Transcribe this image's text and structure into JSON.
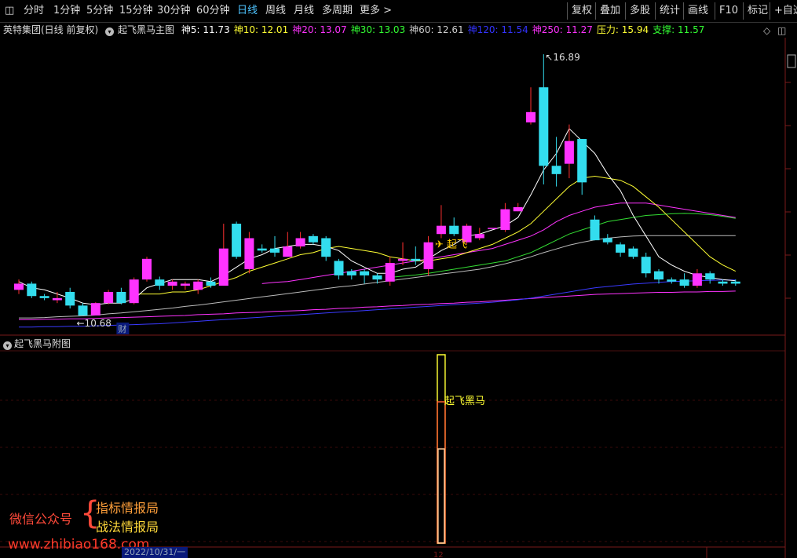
{
  "toolbar": {
    "periods": [
      "分时",
      "1分钟",
      "5分钟",
      "15分钟",
      "30分钟",
      "60分钟",
      "日线",
      "周线",
      "月线",
      "多周期",
      "更多 >"
    ],
    "active_period": "日线",
    "right_buttons": [
      "复权",
      "叠加",
      "多股",
      "统计",
      "画线",
      "F10",
      "标记",
      "+自选"
    ]
  },
  "info": {
    "stock": "英特集团(日线 前复权)",
    "indicator": "起飞黑马主图",
    "ma": [
      {
        "label": "神5: 11.73",
        "color": "#ffffff"
      },
      {
        "label": "神10: 12.01",
        "color": "#ffff33"
      },
      {
        "label": "神20: 13.07",
        "color": "#ff33ff"
      },
      {
        "label": "神30: 13.03",
        "color": "#33ff33"
      },
      {
        "label": "神60: 12.61",
        "color": "#cccccc"
      },
      {
        "label": "神120: 11.54",
        "color": "#3333ff"
      },
      {
        "label": "神250: 11.27",
        "color": "#ff33ff"
      },
      {
        "label": "压力: 15.94",
        "color": "#ffff33"
      },
      {
        "label": "支撑: 11.57",
        "color": "#33ff33"
      }
    ]
  },
  "sub": {
    "title": "起飞黑马附图",
    "signal_label": "起飞黑马"
  },
  "watermark": {
    "line1": "微信公众号",
    "brace": "{",
    "line2": "指标情报局",
    "line3": "战法情报局",
    "url": "www.zhibiao168.com"
  },
  "axis": {
    "date_box": "2022/10/31/一"
  },
  "chart_data": {
    "type": "candlestick",
    "ylim": [
      10.3,
      17.4
    ],
    "up_color": "#ff33ff",
    "down_color": "#33ddee",
    "candles": [
      [
        11.3,
        11.45,
        11.55,
        11.2
      ],
      [
        11.45,
        11.15,
        11.5,
        11.1
      ],
      [
        11.15,
        11.1,
        11.2,
        11.05
      ],
      [
        11.05,
        11.1,
        11.25,
        10.98
      ],
      [
        11.25,
        10.92,
        11.35,
        10.85
      ],
      [
        10.92,
        10.68,
        10.98,
        10.68
      ],
      [
        10.68,
        10.98,
        11.0,
        10.68
      ],
      [
        10.98,
        11.25,
        11.3,
        10.95
      ],
      [
        11.25,
        10.98,
        11.35,
        10.95
      ],
      [
        10.98,
        11.55,
        11.6,
        10.95
      ],
      [
        11.55,
        12.05,
        12.1,
        11.5
      ],
      [
        11.55,
        11.4,
        11.62,
        11.3
      ],
      [
        11.4,
        11.5,
        11.55,
        11.3
      ],
      [
        11.4,
        11.45,
        11.5,
        11.3
      ],
      [
        11.3,
        11.5,
        11.55,
        11.2
      ],
      [
        11.5,
        11.4,
        11.6,
        11.35
      ],
      [
        11.4,
        12.3,
        12.9,
        11.4
      ],
      [
        12.9,
        12.1,
        12.95,
        12.05
      ],
      [
        11.8,
        12.55,
        12.7,
        11.7
      ],
      [
        12.3,
        12.25,
        12.4,
        12.2
      ],
      [
        12.3,
        12.2,
        12.6,
        12.1
      ],
      [
        12.1,
        12.35,
        12.7,
        12.1
      ],
      [
        12.35,
        12.55,
        12.7,
        12.3
      ],
      [
        12.6,
        12.45,
        12.65,
        12.4
      ],
      [
        12.55,
        12.1,
        12.6,
        12.0
      ],
      [
        12.0,
        11.65,
        12.05,
        11.55
      ],
      [
        11.75,
        11.65,
        11.8,
        11.55
      ],
      [
        11.75,
        11.65,
        11.8,
        11.45
      ],
      [
        11.65,
        11.55,
        11.7,
        11.45
      ],
      [
        11.5,
        11.95,
        12.1,
        11.4
      ],
      [
        12.0,
        12.05,
        12.45,
        11.9
      ],
      [
        12.05,
        12.0,
        12.35,
        11.9
      ],
      [
        11.8,
        12.45,
        12.6,
        11.65
      ],
      [
        12.65,
        12.85,
        13.35,
        12.55
      ],
      [
        12.85,
        12.65,
        13.05,
        12.6
      ],
      [
        12.45,
        12.85,
        12.9,
        12.4
      ],
      [
        12.55,
        12.65,
        12.8,
        12.5
      ],
      [
        12.8,
        12.8,
        12.8,
        12.8
      ],
      [
        12.75,
        13.25,
        13.4,
        12.7
      ],
      [
        13.2,
        13.3,
        13.4,
        13.2
      ],
      [
        15.35,
        15.6,
        16.2,
        15.3
      ],
      [
        16.2,
        14.3,
        17.0,
        13.85
      ],
      [
        14.3,
        14.1,
        15.0,
        13.8
      ],
      [
        14.35,
        14.9,
        15.3,
        14.0
      ],
      [
        14.95,
        13.9,
        14.95,
        13.6
      ],
      [
        13.0,
        12.5,
        13.1,
        12.5
      ],
      [
        12.55,
        12.45,
        12.65,
        12.4
      ],
      [
        12.4,
        12.2,
        12.45,
        12.1
      ],
      [
        12.3,
        12.1,
        12.35,
        12.05
      ],
      [
        12.1,
        11.7,
        12.2,
        11.6
      ],
      [
        11.75,
        11.55,
        11.8,
        11.45
      ],
      [
        11.55,
        11.5,
        11.6,
        11.45
      ],
      [
        11.55,
        11.4,
        11.7,
        11.35
      ],
      [
        11.4,
        11.7,
        11.8,
        11.35
      ],
      [
        11.7,
        11.55,
        11.75,
        11.45
      ],
      [
        11.5,
        11.45,
        11.55,
        11.4
      ],
      [
        11.5,
        11.45,
        11.55,
        11.4
      ]
    ],
    "ma5": [
      11.5,
      11.35,
      11.3,
      11.2,
      11.1,
      10.98,
      10.94,
      10.98,
      10.98,
      11.08,
      11.35,
      11.45,
      11.55,
      11.55,
      11.55,
      11.5,
      11.65,
      11.85,
      12.05,
      12.15,
      12.3,
      12.35,
      12.4,
      12.4,
      12.35,
      12.25,
      12.0,
      11.85,
      11.7,
      11.7,
      11.8,
      11.85,
      12.05,
      12.25,
      12.4,
      12.6,
      12.65,
      12.75,
      12.85,
      13.05,
      13.6,
      14.2,
      14.6,
      15.2,
      14.9,
      14.6,
      14.1,
      13.7,
      13.1,
      12.6,
      12.1,
      11.9,
      11.75,
      11.65,
      11.6,
      11.55,
      11.52
    ],
    "ma10": [
      null,
      null,
      null,
      null,
      null,
      null,
      null,
      null,
      null,
      11.2,
      11.2,
      11.2,
      11.25,
      11.25,
      11.3,
      11.4,
      11.5,
      11.6,
      11.75,
      11.85,
      11.95,
      12.05,
      12.15,
      12.2,
      12.3,
      12.35,
      12.3,
      12.25,
      12.2,
      12.1,
      12.05,
      12.0,
      12.0,
      12.05,
      12.1,
      12.2,
      12.3,
      12.4,
      12.55,
      12.7,
      12.9,
      13.2,
      13.5,
      13.8,
      14.0,
      14.05,
      14.0,
      13.95,
      13.8,
      13.55,
      13.3,
      13.0,
      12.7,
      12.4,
      12.1,
      11.9,
      11.75
    ],
    "ma20": [
      null,
      null,
      null,
      null,
      null,
      null,
      null,
      null,
      null,
      null,
      null,
      null,
      null,
      null,
      null,
      null,
      null,
      null,
      null,
      11.45,
      11.48,
      11.5,
      11.55,
      11.6,
      11.65,
      11.7,
      11.75,
      11.8,
      11.85,
      11.9,
      11.95,
      12.0,
      12.05,
      12.1,
      12.15,
      12.2,
      12.25,
      12.3,
      12.4,
      12.5,
      12.6,
      12.75,
      12.95,
      13.1,
      13.2,
      13.3,
      13.35,
      13.4,
      13.4,
      13.4,
      13.35,
      13.3,
      13.25,
      13.2,
      13.15,
      13.1,
      13.05
    ],
    "ma30": [
      null,
      null,
      null,
      null,
      null,
      null,
      null,
      null,
      null,
      null,
      null,
      null,
      null,
      null,
      null,
      null,
      null,
      null,
      null,
      null,
      null,
      null,
      null,
      null,
      null,
      null,
      null,
      null,
      null,
      11.6,
      11.63,
      11.66,
      11.7,
      11.75,
      11.8,
      11.85,
      11.9,
      11.95,
      12.0,
      12.1,
      12.2,
      12.35,
      12.5,
      12.65,
      12.75,
      12.85,
      12.95,
      13.0,
      13.05,
      13.1,
      13.12,
      13.14,
      13.15,
      13.14,
      13.12,
      13.08,
      13.03
    ],
    "ma60": [
      10.62,
      10.62,
      10.63,
      10.65,
      10.66,
      10.67,
      10.69,
      10.72,
      10.74,
      10.77,
      10.8,
      10.83,
      10.86,
      10.9,
      10.93,
      10.97,
      11.01,
      11.05,
      11.09,
      11.13,
      11.17,
      11.21,
      11.25,
      11.29,
      11.33,
      11.37,
      11.4,
      11.44,
      11.48,
      11.52,
      11.56,
      11.6,
      11.64,
      11.68,
      11.72,
      11.76,
      11.8,
      11.86,
      11.93,
      12.01,
      12.1,
      12.2,
      12.29,
      12.38,
      12.45,
      12.51,
      12.55,
      12.58,
      12.6,
      12.61,
      12.61,
      12.61,
      12.61,
      12.61,
      12.61,
      12.61,
      12.61
    ],
    "ma120": [
      10.4,
      10.4,
      10.41,
      10.41,
      10.42,
      10.42,
      10.43,
      10.44,
      10.45,
      10.46,
      10.47,
      10.48,
      10.5,
      10.52,
      10.54,
      10.56,
      10.58,
      10.6,
      10.62,
      10.64,
      10.66,
      10.68,
      10.7,
      10.72,
      10.74,
      10.76,
      10.78,
      10.8,
      10.82,
      10.84,
      10.86,
      10.88,
      10.9,
      10.92,
      10.94,
      10.96,
      10.98,
      11.0,
      11.03,
      11.06,
      11.1,
      11.15,
      11.2,
      11.25,
      11.3,
      11.35,
      11.38,
      11.41,
      11.44,
      11.46,
      11.48,
      11.5,
      11.51,
      11.52,
      11.53,
      11.54,
      11.54
    ],
    "ma250": [
      10.58,
      10.58,
      10.59,
      10.59,
      10.6,
      10.6,
      10.61,
      10.62,
      10.63,
      10.64,
      10.65,
      10.66,
      10.67,
      10.68,
      10.7,
      10.71,
      10.72,
      10.74,
      10.75,
      10.76,
      10.78,
      10.79,
      10.8,
      10.82,
      10.83,
      10.85,
      10.86,
      10.88,
      10.89,
      10.91,
      10.92,
      10.94,
      10.95,
      10.97,
      10.98,
      11.0,
      11.01,
      11.03,
      11.05,
      11.07,
      11.09,
      11.11,
      11.13,
      11.15,
      11.17,
      11.19,
      11.2,
      11.21,
      11.22,
      11.23,
      11.24,
      11.24,
      11.25,
      11.25,
      11.26,
      11.26,
      11.27
    ],
    "annotations": [
      {
        "label": "16.89",
        "index": 41,
        "price": 16.89
      },
      {
        "label": "10.68",
        "index": 5,
        "price": 10.68
      },
      {
        "label": "起飞",
        "index": 33,
        "price": 12.55
      },
      {
        "label": "财",
        "index": 8,
        "price": null
      }
    ],
    "sub_signal": {
      "index": 33,
      "values": [
        1.0,
        0.75,
        0.5
      ]
    },
    "x_tick_labels": [
      "2022/10/31/一",
      "12"
    ]
  }
}
